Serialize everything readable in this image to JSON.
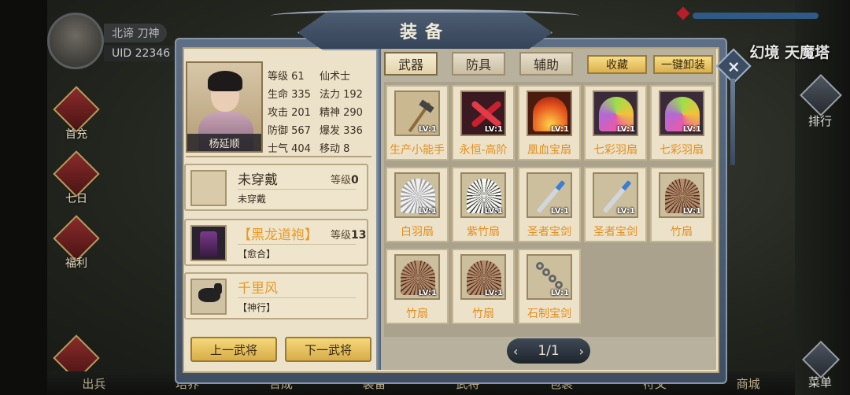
{
  "hud": {
    "player_name": "北谛     刀神",
    "uid": "UID 22346",
    "location": "幻境 天魔塔",
    "left_buttons": [
      "首充",
      "七日",
      "福利",
      "出兵"
    ],
    "rank_label": "排行",
    "menu_label": "菜单",
    "bottom_bar": [
      "出兵",
      "培养",
      "合成",
      "装备",
      "武将",
      "包裹",
      "符文",
      "商城"
    ]
  },
  "dialog": {
    "title": "装备",
    "close_icon": "×"
  },
  "hero": {
    "name": "杨延顺",
    "stats": [
      {
        "label": "等级 61"
      },
      {
        "label": "仙术士"
      },
      {
        "label": "生命 335"
      },
      {
        "label": "法力 192"
      },
      {
        "label": "攻击 201"
      },
      {
        "label": "精神 290"
      },
      {
        "label": "防御 567"
      },
      {
        "label": "爆发 336"
      },
      {
        "label": "士气 404"
      },
      {
        "label": "移动 8"
      }
    ]
  },
  "slots": [
    {
      "name": "未穿戴",
      "level_label": "等级",
      "level": "0",
      "sub": "未穿戴"
    },
    {
      "name": "【黑龙道袍】",
      "level_label": "等级",
      "level": "13",
      "sub": "【愈合】"
    },
    {
      "name": "千里风",
      "level_label": "",
      "level": "",
      "sub": "【神行】"
    }
  ],
  "buttons": {
    "prev_hero": "上一武将",
    "next_hero": "下一武将",
    "favorite": "收藏",
    "unequip_all": "一键卸装"
  },
  "tabs": [
    "武器",
    "防具",
    "辅助"
  ],
  "items": [
    {
      "name": "生产小能手",
      "lv": "LV:1",
      "art": "hoe"
    },
    {
      "name": "永恒-高阶",
      "lv": "LV:1",
      "art": "redbow"
    },
    {
      "name": "凰血宝扇",
      "lv": "LV:1",
      "art": "firefan"
    },
    {
      "name": "七彩羽扇",
      "lv": "LV:1",
      "art": "rainbowfan"
    },
    {
      "name": "七彩羽扇",
      "lv": "LV:1",
      "art": "rainbowfan"
    },
    {
      "name": "白羽扇",
      "lv": "LV:1",
      "art": "whitefan"
    },
    {
      "name": "紫竹扇",
      "lv": "LV:1",
      "art": "bamboofan"
    },
    {
      "name": "圣者宝剑",
      "lv": "LV:1",
      "art": "sword"
    },
    {
      "name": "圣者宝剑",
      "lv": "LV:1",
      "art": "sword"
    },
    {
      "name": "竹扇",
      "lv": "LV:1",
      "art": "brownfan"
    },
    {
      "name": "竹扇",
      "lv": "LV:1",
      "art": "brownfan"
    },
    {
      "name": "竹扇",
      "lv": "LV:1",
      "art": "brownfan"
    },
    {
      "name": "石制宝剑",
      "lv": "LV:1",
      "art": "chain"
    }
  ],
  "pager": {
    "text": "1/1",
    "prev": "‹",
    "next": "›"
  },
  "colors": {
    "accent_orange": "#e58e1f",
    "gold_button": "#f7de86",
    "frame_blue": "#5e6f85",
    "panel_cream": "#ece2c9"
  }
}
